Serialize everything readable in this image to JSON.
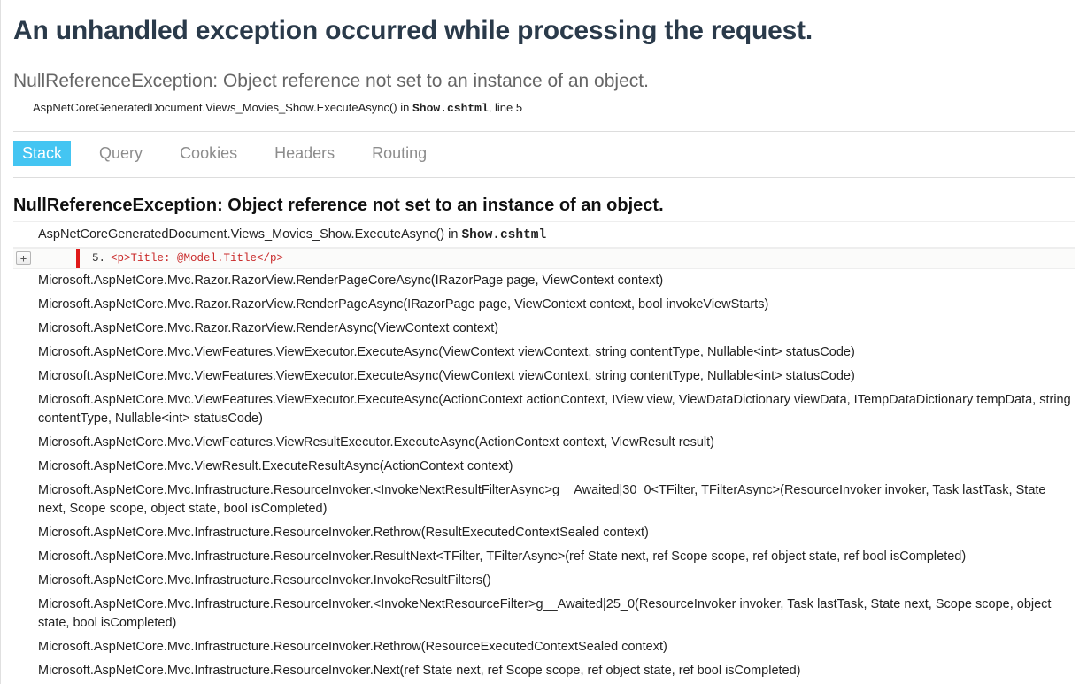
{
  "title": "An unhandled exception occurred while processing the request.",
  "exception": {
    "message": "NullReferenceException: Object reference not set to an instance of an object.",
    "topFrame": {
      "method": "AspNetCoreGeneratedDocument.Views_Movies_Show.ExecuteAsync() in ",
      "file": "Show.cshtml",
      "lineSuffix": ", line 5"
    }
  },
  "tabs": {
    "items": [
      {
        "id": "stack",
        "label": "Stack",
        "active": true
      },
      {
        "id": "query",
        "label": "Query",
        "active": false
      },
      {
        "id": "cookies",
        "label": "Cookies",
        "active": false
      },
      {
        "id": "headers",
        "label": "Headers",
        "active": false
      },
      {
        "id": "routing",
        "label": "Routing",
        "active": false
      }
    ]
  },
  "detail": {
    "heading": "NullReferenceException: Object reference not set to an instance of an object.",
    "firstFrame": {
      "method": "AspNetCoreGeneratedDocument.Views_Movies_Show.ExecuteAsync() in ",
      "file": "Show.cshtml"
    },
    "source": {
      "expand": "+",
      "lineNo": "5.",
      "code": "<p>Title: @Model.Title</p>"
    },
    "frames": [
      "Microsoft.AspNetCore.Mvc.Razor.RazorView.RenderPageCoreAsync(IRazorPage page, ViewContext context)",
      "Microsoft.AspNetCore.Mvc.Razor.RazorView.RenderPageAsync(IRazorPage page, ViewContext context, bool invokeViewStarts)",
      "Microsoft.AspNetCore.Mvc.Razor.RazorView.RenderAsync(ViewContext context)",
      "Microsoft.AspNetCore.Mvc.ViewFeatures.ViewExecutor.ExecuteAsync(ViewContext viewContext, string contentType, Nullable<int> statusCode)",
      "Microsoft.AspNetCore.Mvc.ViewFeatures.ViewExecutor.ExecuteAsync(ViewContext viewContext, string contentType, Nullable<int> statusCode)",
      "Microsoft.AspNetCore.Mvc.ViewFeatures.ViewExecutor.ExecuteAsync(ActionContext actionContext, IView view, ViewDataDictionary viewData, ITempDataDictionary tempData, string contentType, Nullable<int> statusCode)",
      "Microsoft.AspNetCore.Mvc.ViewFeatures.ViewResultExecutor.ExecuteAsync(ActionContext context, ViewResult result)",
      "Microsoft.AspNetCore.Mvc.ViewResult.ExecuteResultAsync(ActionContext context)",
      "Microsoft.AspNetCore.Mvc.Infrastructure.ResourceInvoker.<InvokeNextResultFilterAsync>g__Awaited|30_0<TFilter, TFilterAsync>(ResourceInvoker invoker, Task lastTask, State next, Scope scope, object state, bool isCompleted)",
      "Microsoft.AspNetCore.Mvc.Infrastructure.ResourceInvoker.Rethrow(ResultExecutedContextSealed context)",
      "Microsoft.AspNetCore.Mvc.Infrastructure.ResourceInvoker.ResultNext<TFilter, TFilterAsync>(ref State next, ref Scope scope, ref object state, ref bool isCompleted)",
      "Microsoft.AspNetCore.Mvc.Infrastructure.ResourceInvoker.InvokeResultFilters()",
      "Microsoft.AspNetCore.Mvc.Infrastructure.ResourceInvoker.<InvokeNextResourceFilter>g__Awaited|25_0(ResourceInvoker invoker, Task lastTask, State next, Scope scope, object state, bool isCompleted)",
      "Microsoft.AspNetCore.Mvc.Infrastructure.ResourceInvoker.Rethrow(ResourceExecutedContextSealed context)",
      "Microsoft.AspNetCore.Mvc.Infrastructure.ResourceInvoker.Next(ref State next, ref Scope scope, ref object state, ref bool isCompleted)"
    ]
  }
}
